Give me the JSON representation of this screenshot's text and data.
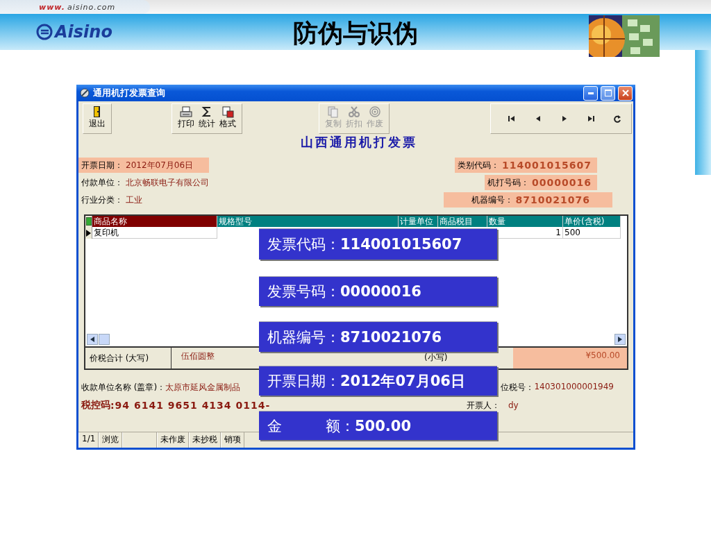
{
  "header": {
    "url_prefix": "www.",
    "url": "aisino.com",
    "logo": "Aisino",
    "title": "防伪与识伪"
  },
  "window": {
    "title": "通用机打发票查询",
    "toolbar": [
      [
        {
          "label": "退出",
          "disabled": false
        }
      ],
      [
        {
          "label": "打印",
          "disabled": false
        },
        {
          "label": "统计",
          "disabled": false
        },
        {
          "label": "格式",
          "disabled": false
        }
      ],
      [
        {
          "label": "复制",
          "disabled": true
        },
        {
          "label": "折扣",
          "disabled": true
        },
        {
          "label": "作废",
          "disabled": true
        }
      ]
    ],
    "form_title": "山西通用机打发票",
    "fields_left": [
      {
        "label": "开票日期：",
        "value": "2012年07月06日",
        "highlighted": true
      },
      {
        "label": "付款单位：",
        "value": "北京畅联电子有限公司",
        "highlighted": false
      },
      {
        "label": "行业分类：",
        "value": "工业",
        "highlighted": false
      }
    ],
    "fields_right": [
      {
        "label": "类别代码：",
        "value": "114001015607",
        "highlighted": true
      },
      {
        "label": "机打号码：",
        "value": "00000016",
        "highlighted": true
      },
      {
        "label": "机器编号：",
        "value": "8710021076",
        "highlighted": true
      }
    ],
    "table": {
      "columns": [
        "商品名称",
        "规格型号",
        "计量单位",
        "商品税目",
        "数量",
        "单价(含税)"
      ],
      "rows": [
        {
          "name": "复印机",
          "quantity": "1",
          "unit_price": "500"
        }
      ]
    },
    "totals": {
      "label": "价税合计 (大写)",
      "amount_words": "伍佰圆整",
      "small_label": "(小写)",
      "amount": "¥500.00",
      "highlighted": true
    },
    "payee": {
      "label": "收款单位名称 (盖章)：",
      "value": "太原市延风金属制品",
      "tax_label": "位税号：",
      "tax_id": "140301000001949"
    },
    "tax_code": {
      "label": "税控码",
      "value": ":94 6141 9651 4134 0114-",
      "issuer_label": "开票人：",
      "issuer": "dy"
    },
    "status_bar": [
      "1/1",
      "浏览",
      "未作废",
      "未抄税",
      "销项"
    ]
  },
  "callouts": [
    {
      "label": "发票代码：",
      "value": "114001015607"
    },
    {
      "label": "发票号码：",
      "value": "00000016"
    },
    {
      "label": "机器编号：",
      "value": "8710021076"
    },
    {
      "label": "开票日期：",
      "value": "2012年07月06日"
    },
    {
      "label": "金　　　额：",
      "value": "500.00"
    }
  ]
}
